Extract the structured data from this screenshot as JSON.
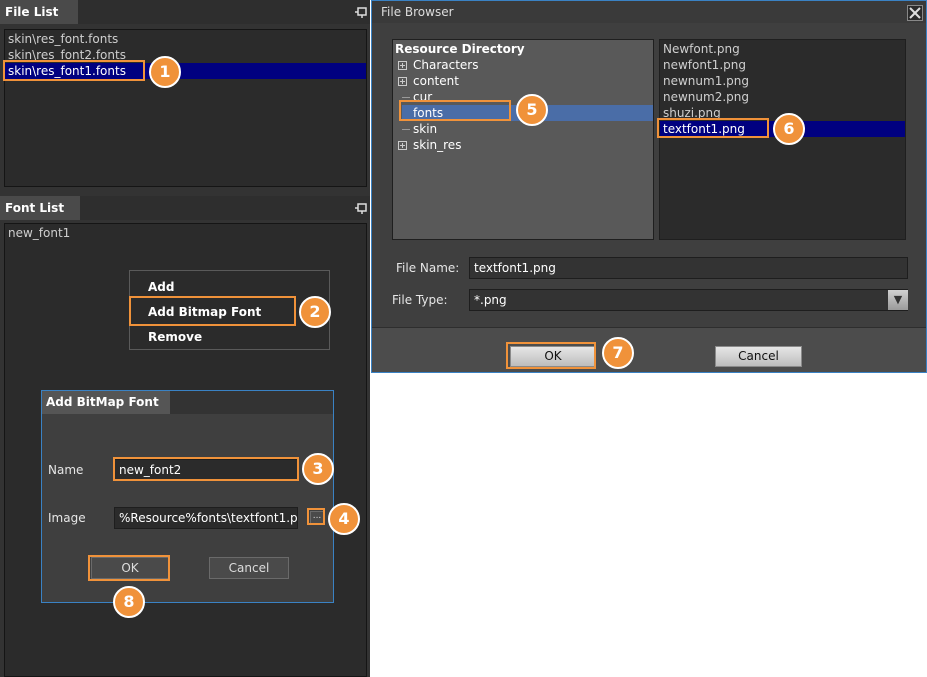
{
  "file_list": {
    "tab": "File List",
    "items": [
      "skin\\res_font.fonts",
      "skin\\res_font2.fonts",
      "skin\\res_font1.fonts"
    ],
    "selected_index": 2
  },
  "font_list": {
    "tab": "Font List",
    "items": [
      "new_font1"
    ]
  },
  "context_menu": {
    "items": [
      "Add",
      "Add Bitmap Font",
      "Remove"
    ]
  },
  "add_bitmap_dialog": {
    "title": "Add BitMap Font",
    "name_label": "Name",
    "name_value": "new_font2",
    "image_label": "Image",
    "image_value": "%Resource%fonts\\textfont1.p",
    "browse_label": "...",
    "ok_label": "OK",
    "cancel_label": "Cancel"
  },
  "file_browser": {
    "title": "File Browser",
    "close_glyph": "✕",
    "tree_root": "Resource Directory",
    "tree_items": [
      "Characters",
      "content",
      "cur",
      "fonts",
      "skin",
      "skin_res"
    ],
    "files": [
      "Newfont.png",
      "newfont1.png",
      "newnum1.png",
      "newnum2.png",
      "shuzi.png",
      "textfont1.png"
    ],
    "file_name_label": "File Name:",
    "file_name_value": "textfont1.png",
    "file_type_label": "File Type:",
    "file_type_value": "*.png",
    "dropdown_glyph": "▼",
    "ok_label": "OK",
    "cancel_label": "Cancel"
  },
  "annotations": [
    "1",
    "2",
    "3",
    "4",
    "5",
    "6",
    "7",
    "8"
  ],
  "colors": {
    "highlight": "#f0923a",
    "selection": "#000080",
    "tree_selection": "#4a6da7",
    "dialog_border": "#3a82c4"
  }
}
